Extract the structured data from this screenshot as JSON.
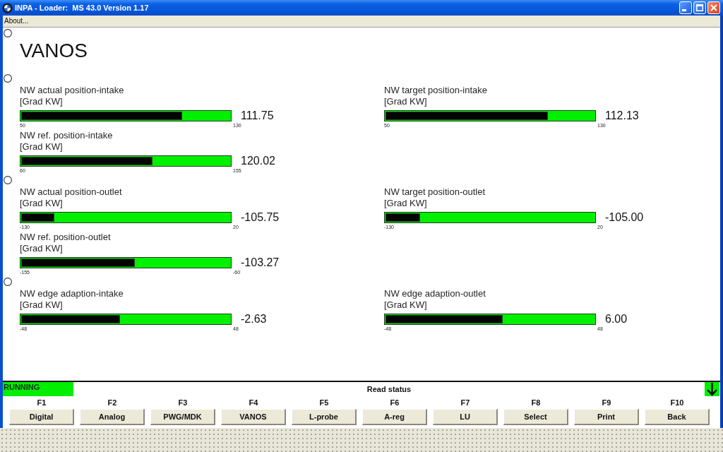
{
  "window": {
    "title": "INPA - Loader:  MS 43.0 Version 1.17"
  },
  "menu": [
    "About..."
  ],
  "screen": {
    "title": "VANOS",
    "sections": [
      {
        "rows": [
          {
            "left": {
              "label": "NW actual position-intake",
              "unit": "[Grad KW]",
              "level": 0.77,
              "value": "111.75",
              "min": "50",
              "max": "130"
            },
            "right": {
              "label": "NW target position-intake",
              "unit": "[Grad KW]",
              "level": 0.777,
              "value": "112.13",
              "min": "50",
              "max": "130"
            }
          },
          {
            "left": {
              "label": "NW ref. position-intake",
              "unit": "[Grad KW]",
              "level": 0.627,
              "value": "120.02",
              "min": "60",
              "max": "155"
            }
          }
        ]
      },
      {
        "rows": [
          {
            "left": {
              "label": "NW actual position-outlet",
              "unit": "[Grad KW]",
              "level": 0.16,
              "value": "-105.75",
              "min": "-130",
              "max": "20"
            },
            "right": {
              "label": "NW target position-outlet",
              "unit": "[Grad KW]",
              "level": 0.167,
              "value": "-105.00",
              "min": "-130",
              "max": "20"
            }
          },
          {
            "left": {
              "label": "NW ref. position-outlet",
              "unit": "[Grad KW]",
              "level": 0.543,
              "value": "-103.27",
              "min": "-155",
              "max": "-60"
            }
          }
        ]
      },
      {
        "rows": [
          {
            "left": {
              "label": "NW edge adaption-intake",
              "unit": "[Grad KW]",
              "level": 0.473,
              "value": "-2.63",
              "min": "-48",
              "max": "48"
            },
            "right": {
              "label": "NW edge adaption-outlet",
              "unit": "[Grad KW]",
              "level": 0.56,
              "value": "6.00",
              "min": "-48",
              "max": "48"
            }
          }
        ]
      }
    ]
  },
  "status_bar": {
    "state": "RUNNING",
    "message": "Read status"
  },
  "function_keys": [
    {
      "key": "F1",
      "label": "Digital"
    },
    {
      "key": "F2",
      "label": "Analog"
    },
    {
      "key": "F3",
      "label": "PWG/MDK"
    },
    {
      "key": "F4",
      "label": "VANOS"
    },
    {
      "key": "F5",
      "label": "L-probe"
    },
    {
      "key": "F6",
      "label": "A-reg"
    },
    {
      "key": "F7",
      "label": "LU"
    },
    {
      "key": "F8",
      "label": "Select"
    },
    {
      "key": "F9",
      "label": "Print"
    },
    {
      "key": "F10",
      "label": "Back"
    }
  ]
}
